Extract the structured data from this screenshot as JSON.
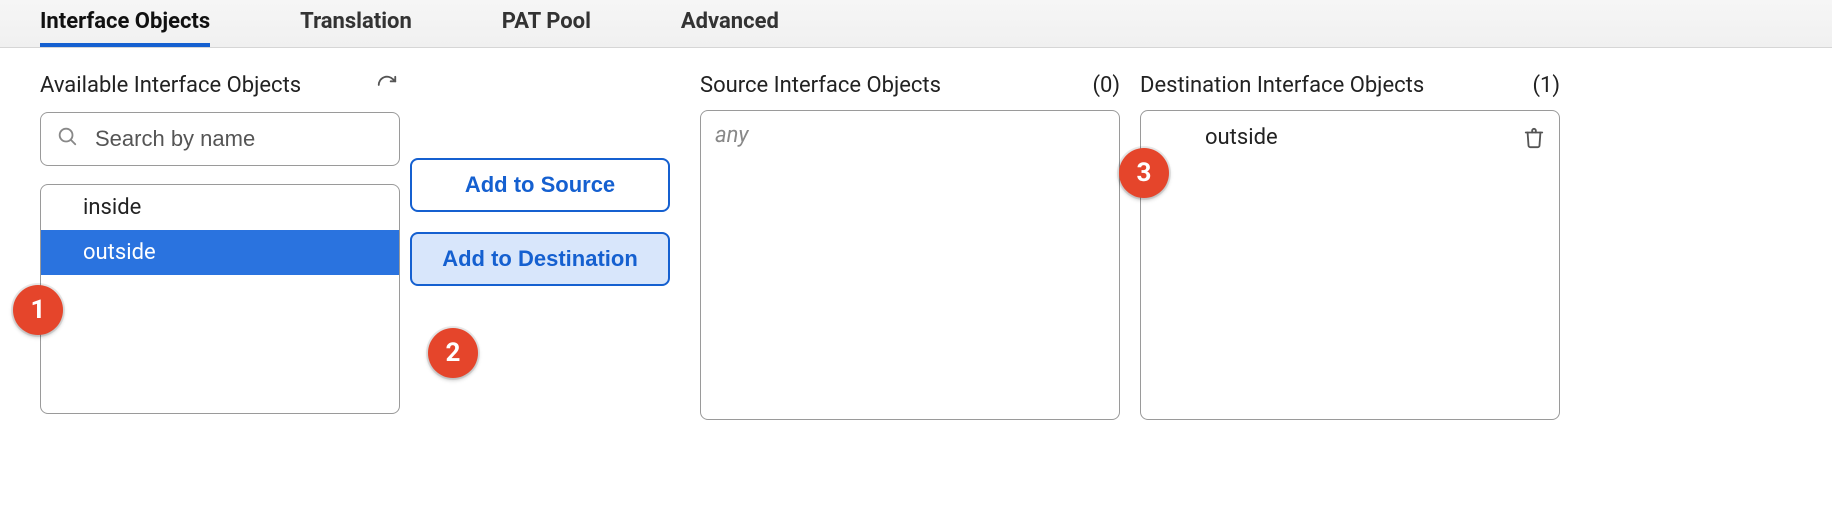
{
  "tabs": {
    "interface_objects": "Interface Objects",
    "translation": "Translation",
    "pat_pool": "PAT Pool",
    "advanced": "Advanced"
  },
  "available": {
    "title": "Available Interface Objects",
    "search_placeholder": "Search by name",
    "items": [
      "inside",
      "outside"
    ],
    "selected_index": 1
  },
  "buttons": {
    "add_source": "Add to Source",
    "add_destination": "Add to Destination"
  },
  "source_panel": {
    "title": "Source Interface Objects",
    "count": "(0)",
    "placeholder": "any",
    "items": []
  },
  "dest_panel": {
    "title": "Destination Interface Objects",
    "count": "(1)",
    "items": [
      "outside"
    ]
  },
  "callouts": {
    "one": "1",
    "two": "2",
    "three": "3"
  }
}
